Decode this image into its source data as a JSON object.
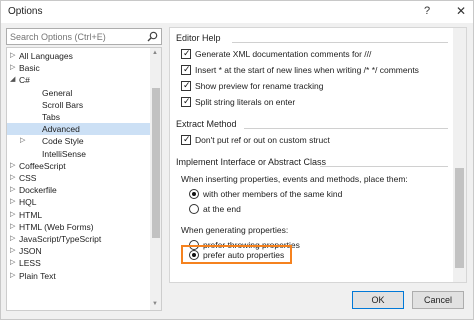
{
  "window": {
    "title": "Options",
    "help_glyph": "?",
    "close_glyph": "✕"
  },
  "search": {
    "placeholder": "Search Options (Ctrl+E)"
  },
  "tree": {
    "items": [
      {
        "label": "All Languages",
        "arrow": "▷",
        "indent": 0,
        "selected": false
      },
      {
        "label": "Basic",
        "arrow": "▷",
        "indent": 0,
        "selected": false
      },
      {
        "label": "C#",
        "arrow": "◢",
        "indent": 0,
        "selected": false
      },
      {
        "label": "General",
        "arrow": "",
        "indent": 1,
        "selected": false
      },
      {
        "label": "Scroll Bars",
        "arrow": "",
        "indent": 1,
        "selected": false
      },
      {
        "label": "Tabs",
        "arrow": "",
        "indent": 1,
        "selected": false
      },
      {
        "label": "Advanced",
        "arrow": "",
        "indent": 1,
        "selected": true
      },
      {
        "label": "Code Style",
        "arrow": "▷",
        "indent": 1,
        "selected": false
      },
      {
        "label": "IntelliSense",
        "arrow": "",
        "indent": 1,
        "selected": false
      },
      {
        "label": "CoffeeScript",
        "arrow": "▷",
        "indent": 0,
        "selected": false
      },
      {
        "label": "CSS",
        "arrow": "▷",
        "indent": 0,
        "selected": false
      },
      {
        "label": "Dockerfile",
        "arrow": "▷",
        "indent": 0,
        "selected": false
      },
      {
        "label": "HQL",
        "arrow": "▷",
        "indent": 0,
        "selected": false
      },
      {
        "label": "HTML",
        "arrow": "▷",
        "indent": 0,
        "selected": false
      },
      {
        "label": "HTML (Web Forms)",
        "arrow": "▷",
        "indent": 0,
        "selected": false
      },
      {
        "label": "JavaScript/TypeScript",
        "arrow": "▷",
        "indent": 0,
        "selected": false
      },
      {
        "label": "JSON",
        "arrow": "▷",
        "indent": 0,
        "selected": false
      },
      {
        "label": "LESS",
        "arrow": "▷",
        "indent": 0,
        "selected": false
      },
      {
        "label": "Plain Text",
        "arrow": "▷",
        "indent": 0,
        "selected": false
      }
    ]
  },
  "editor_help": {
    "title": "Editor Help",
    "options": [
      {
        "label": "Generate XML documentation comments for ///",
        "checked": true
      },
      {
        "label": "Insert * at the start of new lines when writing /* */ comments",
        "checked": true
      },
      {
        "label": "Show preview for rename tracking",
        "checked": true
      },
      {
        "label": "Split string literals on enter",
        "checked": true
      }
    ]
  },
  "extract_method": {
    "title": "Extract Method",
    "options": [
      {
        "label": "Don't put ref or out on custom struct",
        "checked": true
      }
    ]
  },
  "implement_interface": {
    "title": "Implement Interface or Abstract Class",
    "placement_prompt": "When inserting properties, events and methods, place them:",
    "placement_options": [
      {
        "label": "with other members of the same kind",
        "selected": true
      },
      {
        "label": "at the end",
        "selected": false
      }
    ],
    "generating_prompt": "When generating properties:",
    "generating_options": [
      {
        "label": "prefer throwing properties",
        "selected": false
      },
      {
        "label": "prefer auto properties",
        "selected": true
      }
    ]
  },
  "buttons": {
    "ok": "OK",
    "cancel": "Cancel"
  },
  "colors": {
    "highlight": "#f5821f",
    "selection": "#cce0f5",
    "ok_border": "#0078d7"
  }
}
